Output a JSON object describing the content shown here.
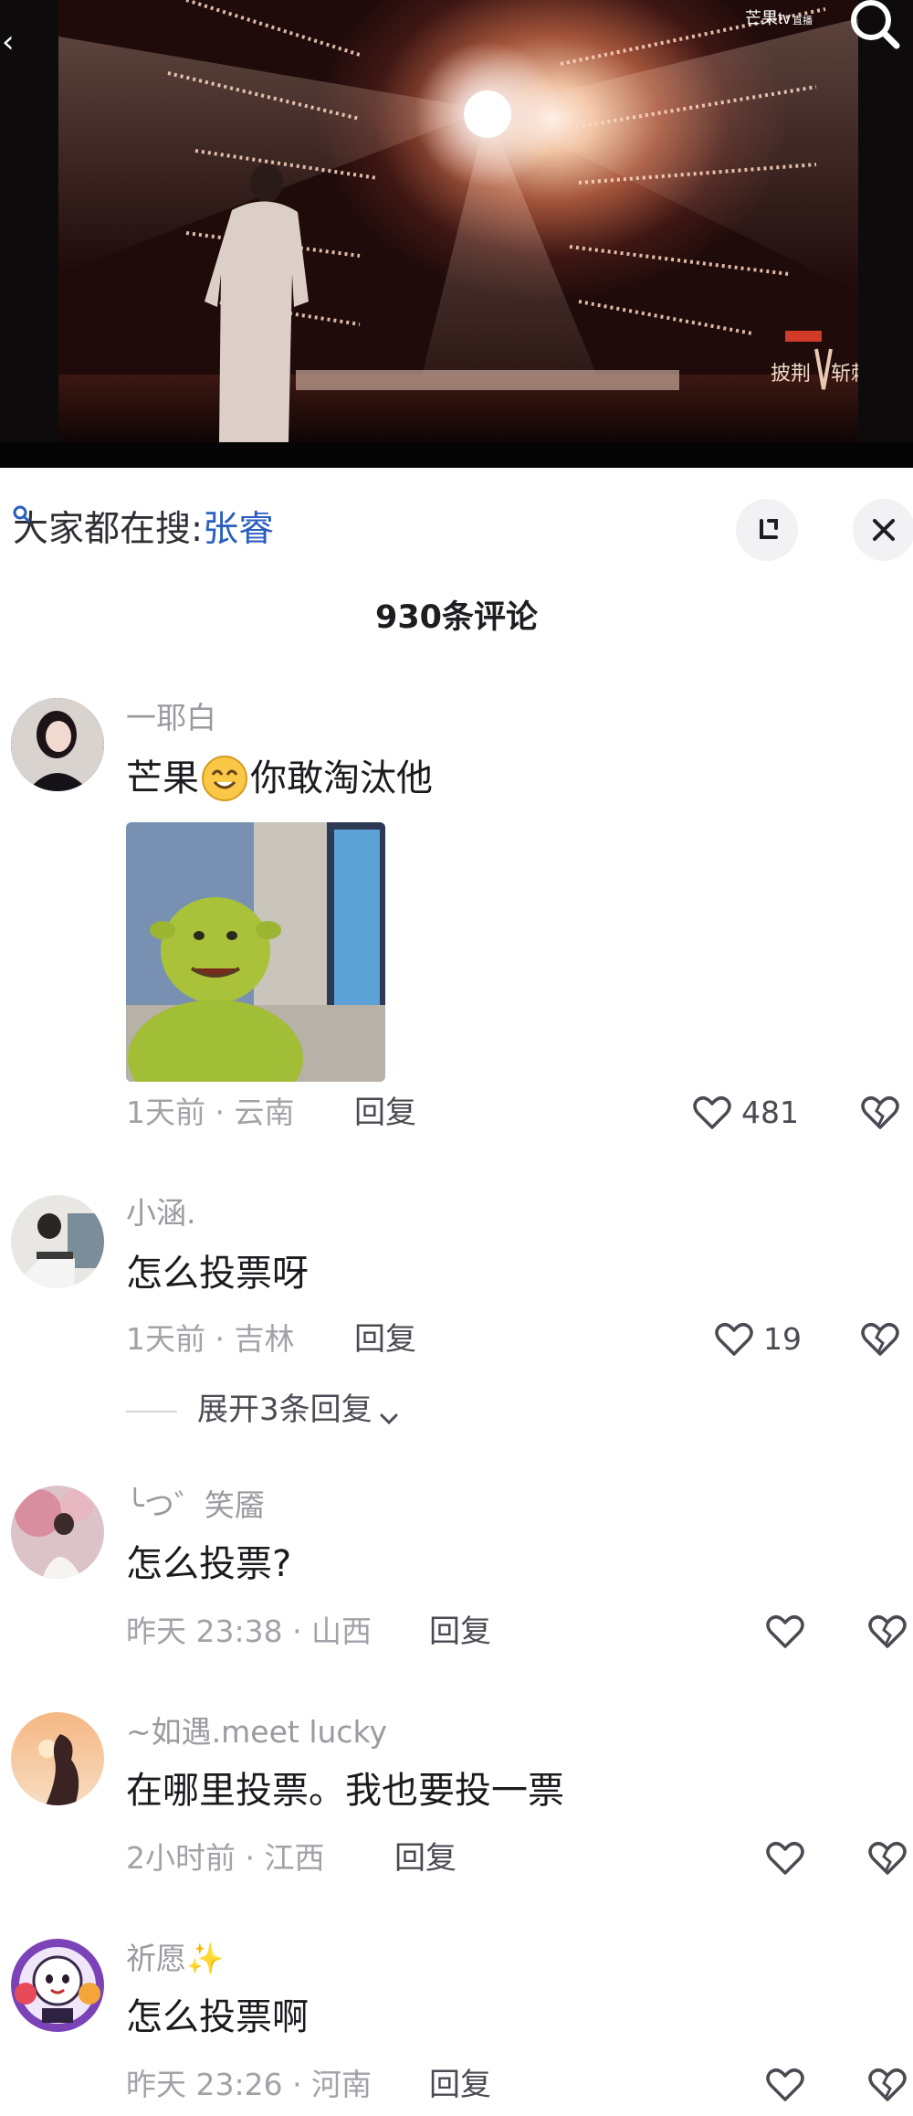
{
  "video": {
    "back_glyph": "‹",
    "platform_logo": "芒果tv",
    "platform_logo_sub": "直播",
    "search_icon": "search-icon",
    "show_logo_icon": "show-logo"
  },
  "search_bar": {
    "prefix": "大家都在搜:",
    "keyword": "张睿",
    "expand_icon": "expand-icon",
    "close_icon": "close-icon"
  },
  "comment_count": "930条评论",
  "comments": [
    {
      "user": "一耶白",
      "text_before": "芒果",
      "emoji": "smile-emoji",
      "text_after": "你敢淘汰他",
      "has_gif": true,
      "meta": "1天前 · 云南",
      "reply": "回复",
      "likes": "481"
    },
    {
      "user": "小涵.",
      "text": "怎么投票呀",
      "meta": "1天前 · 吉林",
      "reply": "回复",
      "likes": "19",
      "expand_replies": "展开3条回复"
    },
    {
      "user": "╰つ゛笑靥",
      "text": "怎么投票?",
      "meta": "昨天 23:38 · 山西",
      "reply": "回复",
      "likes": ""
    },
    {
      "user": "~如遇.meet lucky",
      "text": "在哪里投票。我也要投一票",
      "meta": "2小时前 · 江西",
      "reply": "回复",
      "likes": ""
    },
    {
      "user": "祈愿",
      "user_emoji": "✨",
      "text": "怎么投票啊",
      "meta": "昨天 23:26 · 河南",
      "reply": "回复",
      "likes": ""
    }
  ],
  "colors": {
    "keyword_blue": "#2a5fbf",
    "meta_gray": "#a2a2a8",
    "text_dark": "#1a1a1f"
  }
}
